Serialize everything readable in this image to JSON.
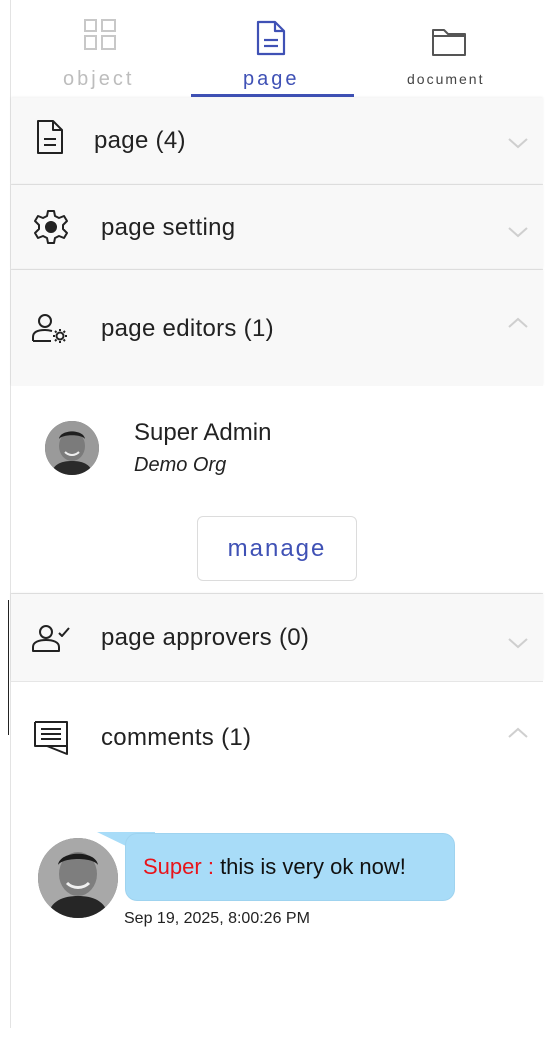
{
  "tabs": [
    {
      "label": "object",
      "icon": "grid-icon",
      "active": false
    },
    {
      "label": "page",
      "icon": "page-icon",
      "active": true
    },
    {
      "label": "document",
      "icon": "folder-icon",
      "active": false
    }
  ],
  "accent_color": "#3f51b5",
  "sections": {
    "page": {
      "title": "page (4)",
      "icon": "document-icon",
      "expanded": false
    },
    "setting": {
      "title": "page setting",
      "icon": "gear-icon",
      "expanded": false
    },
    "editors": {
      "title": "page editors (1)",
      "icon": "user-gear-icon",
      "expanded": true
    },
    "approvers": {
      "title": "page approvers (0)",
      "icon": "user-check-icon",
      "expanded": false
    },
    "comments": {
      "title": "comments (1)",
      "icon": "comment-icon",
      "expanded": true
    }
  },
  "editors": [
    {
      "name": "Super Admin",
      "org": "Demo Org"
    }
  ],
  "manage_label": "manage",
  "comments": [
    {
      "author": "Super :",
      "text": "this is very ok now!",
      "timestamp": "Sep 19, 2025, 8:00:26 PM"
    }
  ],
  "comment_author_color": "#e8141b",
  "bubble_color": "#a8dcf8"
}
